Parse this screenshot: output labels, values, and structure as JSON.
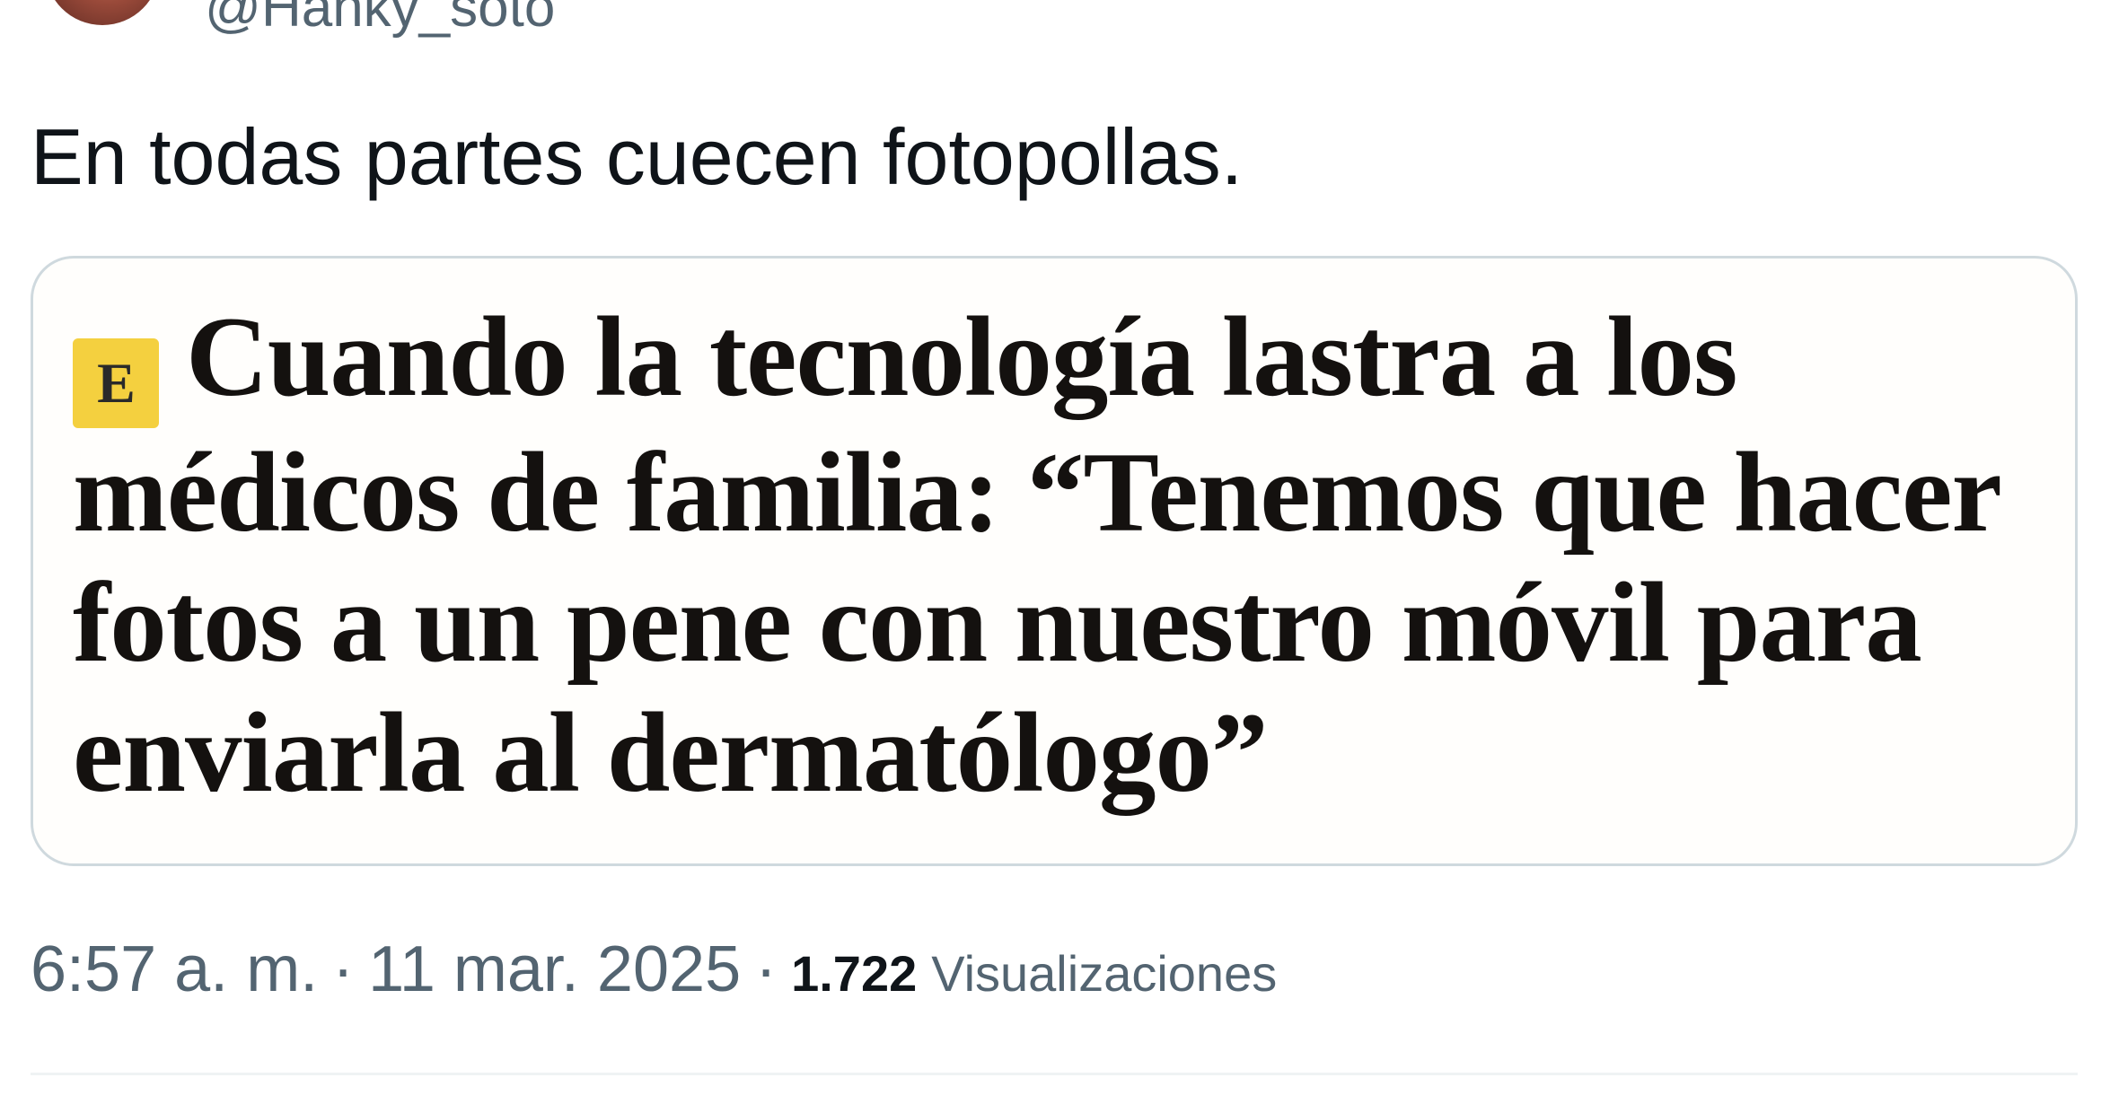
{
  "author": {
    "handle": "@Hanky_soto"
  },
  "tweet": {
    "text": "En todas partes cuecen fotopollas."
  },
  "media": {
    "logo_letter": "E",
    "headline": "Cuando la tecnología lastra a los médicos de familia: “Tenemos que hacer fotos a un pene con nuestro móvil para enviarla al dermatólogo”"
  },
  "meta": {
    "time": "6:57 a. m.",
    "separator": "·",
    "date": "11 mar. 2025",
    "views_count": "1.722",
    "views_label": "Visualizaciones"
  },
  "colors": {
    "text_primary": "#0f1419",
    "text_secondary": "#536471",
    "border": "#cfd9de",
    "logo_badge": "#f4d03f"
  }
}
